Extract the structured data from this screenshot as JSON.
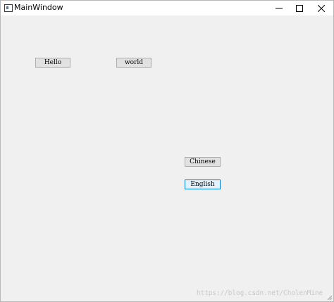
{
  "window": {
    "title": "MainWindow",
    "icon": "app-window-icon",
    "controls": {
      "minimize_icon": "minimize-icon",
      "maximize_icon": "maximize-icon",
      "close_icon": "close-icon"
    }
  },
  "buttons": {
    "hello_label": "Hello",
    "world_label": "world",
    "chinese_label": "Chinese",
    "english_label": "English"
  },
  "watermark": {
    "text": "https://blog.csdn.net/CholenMine"
  },
  "colors": {
    "client_background": "#f0f0f0",
    "button_face": "#e1e1e1",
    "focus_border": "#0078d7"
  }
}
